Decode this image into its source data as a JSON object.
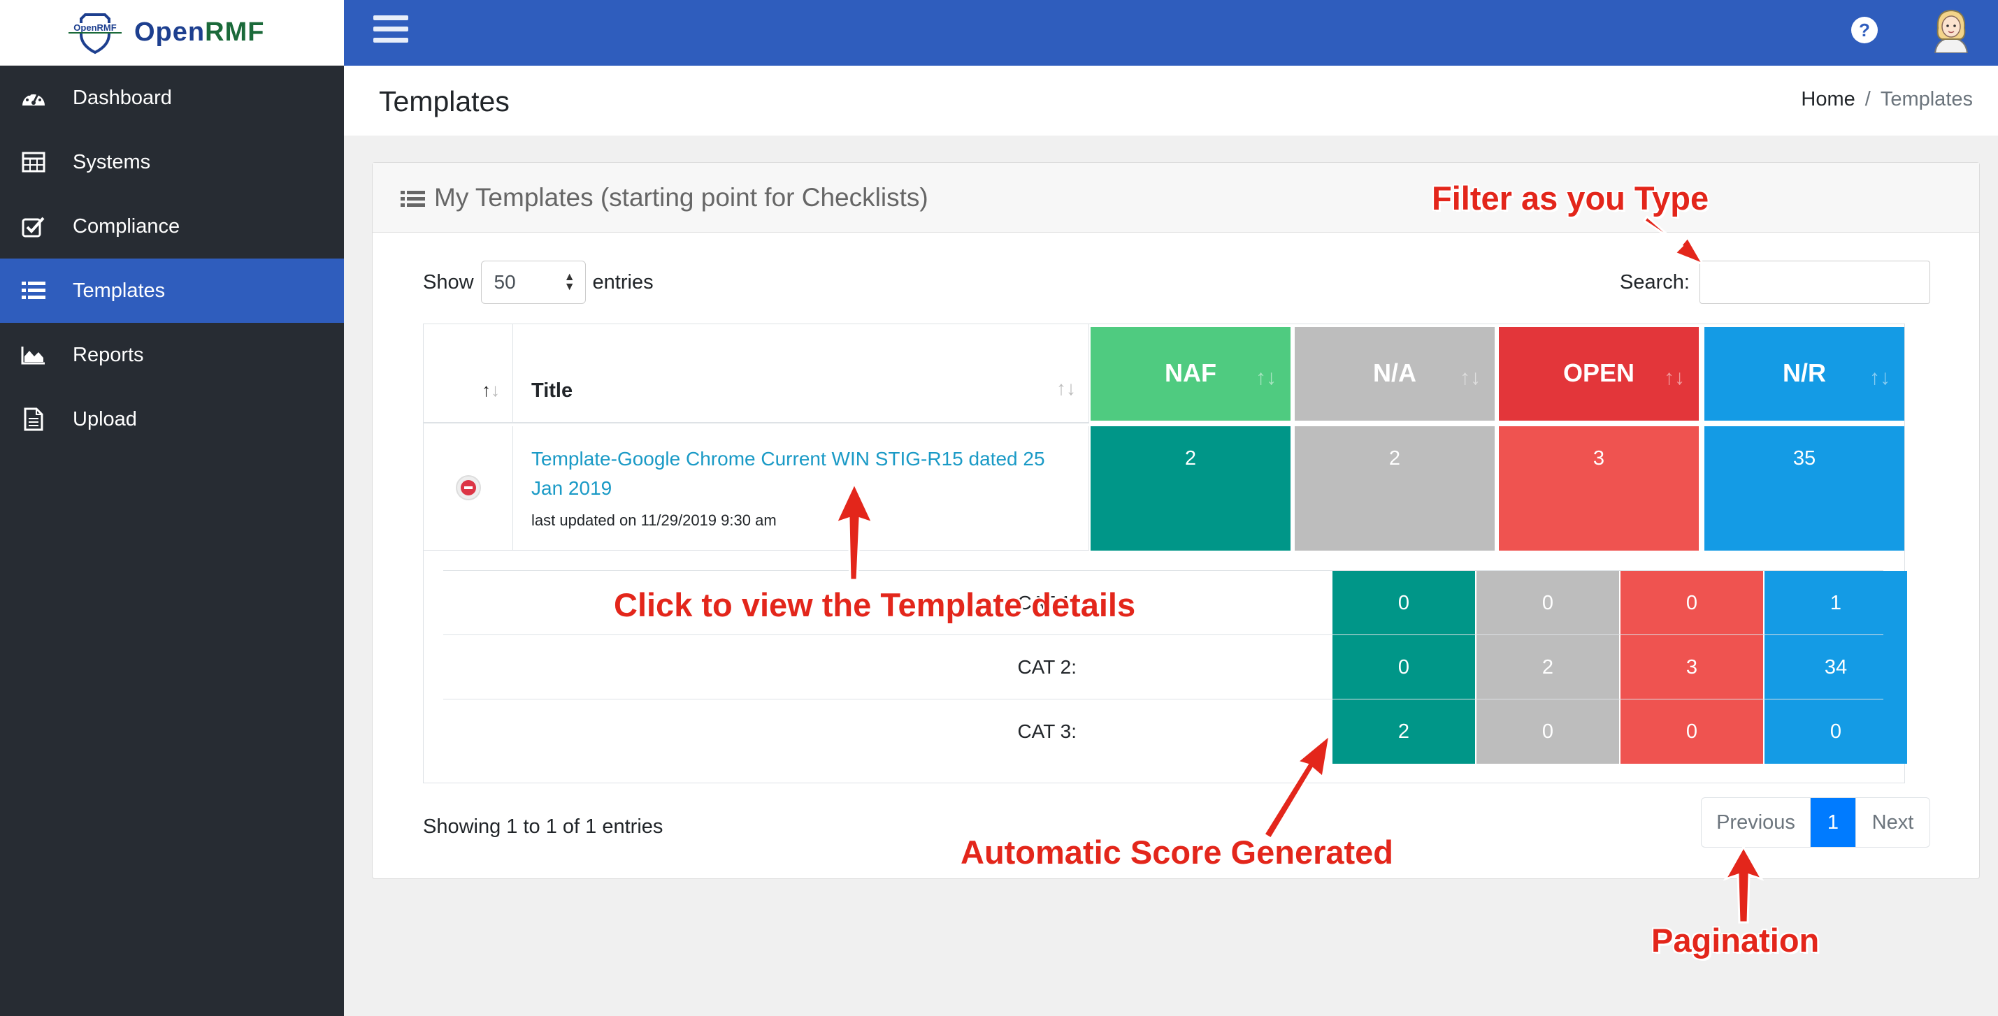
{
  "brand": {
    "logo_text": "OpenRMF",
    "name_part1": "Open",
    "name_part2": "RMF"
  },
  "sidebar": {
    "items": [
      {
        "label": "Dashboard",
        "icon": "dashboard-icon"
      },
      {
        "label": "Systems",
        "icon": "table-icon"
      },
      {
        "label": "Compliance",
        "icon": "checkbox-icon"
      },
      {
        "label": "Templates",
        "icon": "list-icon",
        "active": true
      },
      {
        "label": "Reports",
        "icon": "area-chart-icon"
      },
      {
        "label": "Upload",
        "icon": "file-icon"
      }
    ]
  },
  "topbar": {
    "help": "?"
  },
  "page": {
    "title": "Templates"
  },
  "breadcrumb": {
    "home": "Home",
    "sep": "/",
    "current": "Templates"
  },
  "card": {
    "title": "My Templates (starting point for Checklists)",
    "show_label": "Show",
    "entries_value": "50",
    "entries_label": "entries",
    "search_label": "Search:",
    "search_value": ""
  },
  "table": {
    "header": {
      "title": "Title",
      "naf": "NAF",
      "na": "N/A",
      "open": "OPEN",
      "nr": "N/R"
    },
    "row": {
      "title": "Template-Google Chrome Current WIN STIG-R15 dated 25 Jan 2019",
      "updated": "last updated on 11/29/2019 9:30 am",
      "naf": "2",
      "na": "2",
      "open": "3",
      "nr": "35"
    },
    "cats": [
      {
        "label": "CAT 1:",
        "naf": "0",
        "na": "0",
        "open": "0",
        "nr": "1"
      },
      {
        "label": "CAT 2:",
        "naf": "0",
        "na": "2",
        "open": "3",
        "nr": "34"
      },
      {
        "label": "CAT 3:",
        "naf": "2",
        "na": "0",
        "open": "0",
        "nr": "0"
      }
    ]
  },
  "footer": {
    "showing": "Showing 1 to 1 of 1 entries",
    "previous": "Previous",
    "current_page": "1",
    "next": "Next"
  },
  "annotations": {
    "filter": "Filter as you Type",
    "click": "Click to view the Template details",
    "score": "Automatic Score Generated",
    "pagination": "Pagination"
  },
  "colors": {
    "naf_header": "#4fcb80",
    "na_header": "#bdbdbd",
    "open_header": "#e3363a",
    "nr_header": "#149be5",
    "naf_cell": "#009688",
    "na_cell": "#bdbdbd",
    "open_cell": "#ef5350",
    "nr_cell": "#149be5",
    "annotation": "#e3261b"
  }
}
